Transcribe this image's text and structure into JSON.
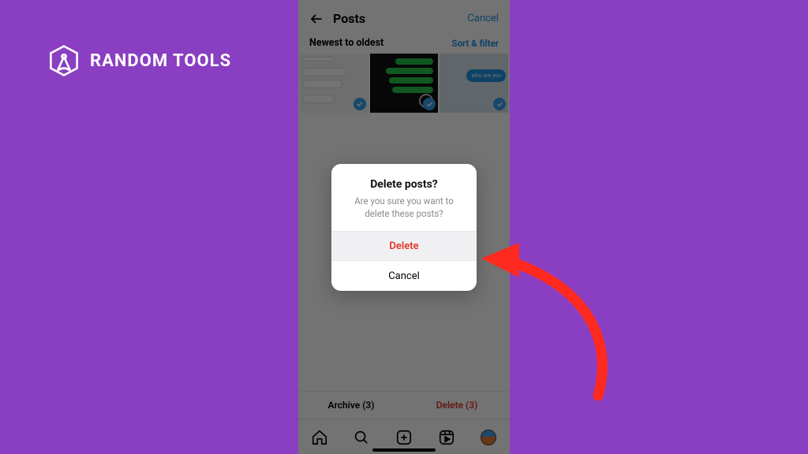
{
  "brand": {
    "name": "RANDOM TOOLS"
  },
  "header": {
    "title": "Posts",
    "cancel": "Cancel"
  },
  "sort": {
    "label": "Newest to oldest",
    "filter": "Sort & filter"
  },
  "thumb3": {
    "bubble": "who are you"
  },
  "actionbar": {
    "archive": "Archive (3)",
    "delete": "Delete (3)"
  },
  "alert": {
    "title": "Delete posts?",
    "message_l1": "Are you sure you want to",
    "message_l2": "delete these posts?",
    "delete": "Delete",
    "cancel": "Cancel"
  },
  "colors": {
    "bg": "#8a3fc2",
    "accent": "#1f93e0",
    "danger": "#e0352b"
  }
}
